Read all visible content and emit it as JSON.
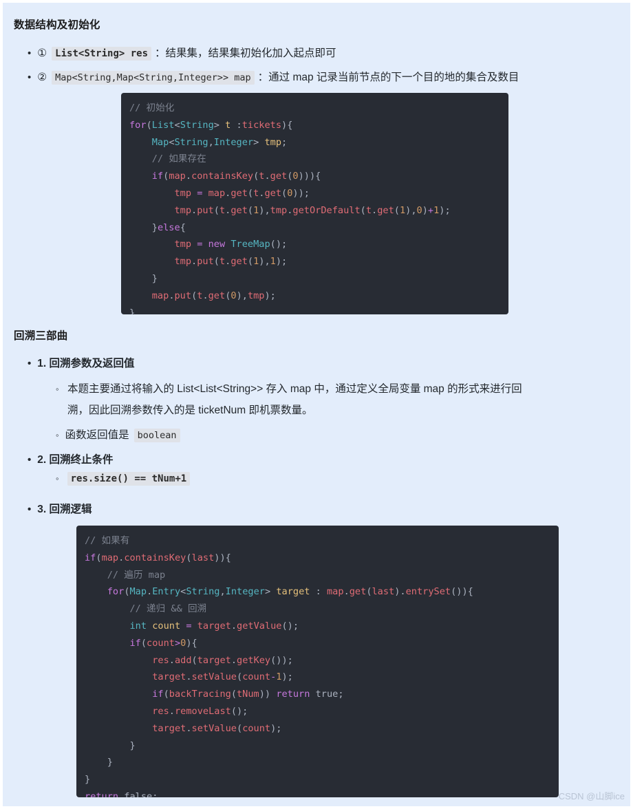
{
  "document": {
    "watermark": "CSDN @山脚ice"
  },
  "section1": {
    "heading": "数据结构及初始化",
    "items": [
      {
        "marker": "①",
        "code": "List<String> res",
        "text": "：结果集，结果集初始化加入起点即可"
      },
      {
        "marker": "②",
        "code": "Map<String,Map<String,Integer>> map",
        "text": "：通过 map 记录当前节点的下一个目的地的集合及数目"
      }
    ]
  },
  "code_block_1": {
    "lines": [
      [
        {
          "t": "// 初始化",
          "c": "c-com"
        }
      ],
      [
        {
          "t": "for",
          "c": "c-kw"
        },
        {
          "t": "(",
          "c": "c-pun"
        },
        {
          "t": "List",
          "c": "c-typ"
        },
        {
          "t": "<",
          "c": "c-pun"
        },
        {
          "t": "String",
          "c": "c-typ"
        },
        {
          "t": "> ",
          "c": "c-pun"
        },
        {
          "t": "t ",
          "c": "c-var"
        },
        {
          "t": ":",
          "c": "c-pun"
        },
        {
          "t": "tickets",
          "c": "c-fn"
        },
        {
          "t": "){",
          "c": "c-pun"
        }
      ],
      [
        {
          "t": "    ",
          "c": "c-pln"
        },
        {
          "t": "Map",
          "c": "c-typ"
        },
        {
          "t": "<",
          "c": "c-pun"
        },
        {
          "t": "String",
          "c": "c-typ"
        },
        {
          "t": ",",
          "c": "c-pun"
        },
        {
          "t": "Integer",
          "c": "c-typ"
        },
        {
          "t": "> ",
          "c": "c-pun"
        },
        {
          "t": "tmp",
          "c": "c-var"
        },
        {
          "t": ";",
          "c": "c-pun"
        }
      ],
      [
        {
          "t": "    ",
          "c": "c-pln"
        },
        {
          "t": "// 如果存在",
          "c": "c-com"
        }
      ],
      [
        {
          "t": "    ",
          "c": "c-pln"
        },
        {
          "t": "if",
          "c": "c-kw"
        },
        {
          "t": "(",
          "c": "c-pun"
        },
        {
          "t": "map",
          "c": "c-fn"
        },
        {
          "t": ".",
          "c": "c-pun"
        },
        {
          "t": "containsKey",
          "c": "c-fn"
        },
        {
          "t": "(",
          "c": "c-pun"
        },
        {
          "t": "t",
          "c": "c-fn"
        },
        {
          "t": ".",
          "c": "c-pun"
        },
        {
          "t": "get",
          "c": "c-fn"
        },
        {
          "t": "(",
          "c": "c-pun"
        },
        {
          "t": "0",
          "c": "c-num"
        },
        {
          "t": "))){",
          "c": "c-pun"
        }
      ],
      [
        {
          "t": "        ",
          "c": "c-pln"
        },
        {
          "t": "tmp ",
          "c": "c-fn"
        },
        {
          "t": "= ",
          "c": "c-op"
        },
        {
          "t": "map",
          "c": "c-fn"
        },
        {
          "t": ".",
          "c": "c-pun"
        },
        {
          "t": "get",
          "c": "c-fn"
        },
        {
          "t": "(",
          "c": "c-pun"
        },
        {
          "t": "t",
          "c": "c-fn"
        },
        {
          "t": ".",
          "c": "c-pun"
        },
        {
          "t": "get",
          "c": "c-fn"
        },
        {
          "t": "(",
          "c": "c-pun"
        },
        {
          "t": "0",
          "c": "c-num"
        },
        {
          "t": "));",
          "c": "c-pun"
        }
      ],
      [
        {
          "t": "        ",
          "c": "c-pln"
        },
        {
          "t": "tmp",
          "c": "c-fn"
        },
        {
          "t": ".",
          "c": "c-pun"
        },
        {
          "t": "put",
          "c": "c-fn"
        },
        {
          "t": "(",
          "c": "c-pun"
        },
        {
          "t": "t",
          "c": "c-fn"
        },
        {
          "t": ".",
          "c": "c-pun"
        },
        {
          "t": "get",
          "c": "c-fn"
        },
        {
          "t": "(",
          "c": "c-pun"
        },
        {
          "t": "1",
          "c": "c-num"
        },
        {
          "t": "),",
          "c": "c-pun"
        },
        {
          "t": "tmp",
          "c": "c-fn"
        },
        {
          "t": ".",
          "c": "c-pun"
        },
        {
          "t": "getOrDefault",
          "c": "c-fn"
        },
        {
          "t": "(",
          "c": "c-pun"
        },
        {
          "t": "t",
          "c": "c-fn"
        },
        {
          "t": ".",
          "c": "c-pun"
        },
        {
          "t": "get",
          "c": "c-fn"
        },
        {
          "t": "(",
          "c": "c-pun"
        },
        {
          "t": "1",
          "c": "c-num"
        },
        {
          "t": "),",
          "c": "c-pun"
        },
        {
          "t": "0",
          "c": "c-num"
        },
        {
          "t": ")",
          "c": "c-pun"
        },
        {
          "t": "+",
          "c": "c-op"
        },
        {
          "t": "1",
          "c": "c-num"
        },
        {
          "t": ");",
          "c": "c-pun"
        }
      ],
      [
        {
          "t": "    ",
          "c": "c-pln"
        },
        {
          "t": "}",
          "c": "c-pun"
        },
        {
          "t": "else",
          "c": "c-kw"
        },
        {
          "t": "{",
          "c": "c-pun"
        }
      ],
      [
        {
          "t": "        ",
          "c": "c-pln"
        },
        {
          "t": "tmp ",
          "c": "c-fn"
        },
        {
          "t": "= ",
          "c": "c-op"
        },
        {
          "t": "new ",
          "c": "c-kw"
        },
        {
          "t": "TreeMap",
          "c": "c-typ"
        },
        {
          "t": "();",
          "c": "c-pun"
        }
      ],
      [
        {
          "t": "        ",
          "c": "c-pln"
        },
        {
          "t": "tmp",
          "c": "c-fn"
        },
        {
          "t": ".",
          "c": "c-pun"
        },
        {
          "t": "put",
          "c": "c-fn"
        },
        {
          "t": "(",
          "c": "c-pun"
        },
        {
          "t": "t",
          "c": "c-fn"
        },
        {
          "t": ".",
          "c": "c-pun"
        },
        {
          "t": "get",
          "c": "c-fn"
        },
        {
          "t": "(",
          "c": "c-pun"
        },
        {
          "t": "1",
          "c": "c-num"
        },
        {
          "t": "),",
          "c": "c-pun"
        },
        {
          "t": "1",
          "c": "c-num"
        },
        {
          "t": ");",
          "c": "c-pun"
        }
      ],
      [
        {
          "t": "    ",
          "c": "c-pln"
        },
        {
          "t": "}",
          "c": "c-pun"
        }
      ],
      [
        {
          "t": "    ",
          "c": "c-pln"
        },
        {
          "t": "map",
          "c": "c-fn"
        },
        {
          "t": ".",
          "c": "c-pun"
        },
        {
          "t": "put",
          "c": "c-fn"
        },
        {
          "t": "(",
          "c": "c-pun"
        },
        {
          "t": "t",
          "c": "c-fn"
        },
        {
          "t": ".",
          "c": "c-pun"
        },
        {
          "t": "get",
          "c": "c-fn"
        },
        {
          "t": "(",
          "c": "c-pun"
        },
        {
          "t": "0",
          "c": "c-num"
        },
        {
          "t": "),",
          "c": "c-pun"
        },
        {
          "t": "tmp",
          "c": "c-fn"
        },
        {
          "t": ");",
          "c": "c-pun"
        }
      ],
      [
        {
          "t": "}",
          "c": "c-pun"
        }
      ]
    ]
  },
  "section2": {
    "heading": "回溯三部曲",
    "item1": {
      "label": "1. 回溯参数及返回值",
      "paragraph_line1": "本题主要通过将输入的 List<List<String>> 存入 map 中，通过定义全局变量 map 的形式来进行回",
      "paragraph_line2": "溯，因此回溯参数传入的是 ticketNum 即机票数量。",
      "subitem_text": "函数返回值是",
      "subitem_code": "boolean"
    },
    "item2": {
      "label": "2. 回溯终止条件",
      "code": "res.size() == tNum+1"
    },
    "item3": {
      "label": "3. 回溯逻辑"
    }
  },
  "code_block_2": {
    "lines": [
      [
        {
          "t": "// 如果有",
          "c": "c-com"
        }
      ],
      [
        {
          "t": "if",
          "c": "c-kw"
        },
        {
          "t": "(",
          "c": "c-pun"
        },
        {
          "t": "map",
          "c": "c-fn"
        },
        {
          "t": ".",
          "c": "c-pun"
        },
        {
          "t": "containsKey",
          "c": "c-fn"
        },
        {
          "t": "(",
          "c": "c-pun"
        },
        {
          "t": "last",
          "c": "c-fn"
        },
        {
          "t": ")){",
          "c": "c-pun"
        }
      ],
      [
        {
          "t": "    ",
          "c": "c-pln"
        },
        {
          "t": "// 遍历 map",
          "c": "c-com"
        }
      ],
      [
        {
          "t": "    ",
          "c": "c-pln"
        },
        {
          "t": "for",
          "c": "c-kw"
        },
        {
          "t": "(",
          "c": "c-pun"
        },
        {
          "t": "Map",
          "c": "c-typ"
        },
        {
          "t": ".",
          "c": "c-pun"
        },
        {
          "t": "Entry",
          "c": "c-typ"
        },
        {
          "t": "<",
          "c": "c-pun"
        },
        {
          "t": "String",
          "c": "c-typ"
        },
        {
          "t": ",",
          "c": "c-pun"
        },
        {
          "t": "Integer",
          "c": "c-typ"
        },
        {
          "t": "> ",
          "c": "c-pun"
        },
        {
          "t": "target ",
          "c": "c-var"
        },
        {
          "t": ": ",
          "c": "c-pun"
        },
        {
          "t": "map",
          "c": "c-fn"
        },
        {
          "t": ".",
          "c": "c-pun"
        },
        {
          "t": "get",
          "c": "c-fn"
        },
        {
          "t": "(",
          "c": "c-pun"
        },
        {
          "t": "last",
          "c": "c-fn"
        },
        {
          "t": ").",
          "c": "c-pun"
        },
        {
          "t": "entrySet",
          "c": "c-fn"
        },
        {
          "t": "()){",
          "c": "c-pun"
        }
      ],
      [
        {
          "t": "        ",
          "c": "c-pln"
        },
        {
          "t": "// 递归 && 回溯",
          "c": "c-com"
        }
      ],
      [
        {
          "t": "        ",
          "c": "c-pln"
        },
        {
          "t": "int ",
          "c": "c-typ"
        },
        {
          "t": "count ",
          "c": "c-var"
        },
        {
          "t": "= ",
          "c": "c-op"
        },
        {
          "t": "target",
          "c": "c-fn"
        },
        {
          "t": ".",
          "c": "c-pun"
        },
        {
          "t": "getValue",
          "c": "c-fn"
        },
        {
          "t": "();",
          "c": "c-pun"
        }
      ],
      [
        {
          "t": "        ",
          "c": "c-pln"
        },
        {
          "t": "if",
          "c": "c-kw"
        },
        {
          "t": "(",
          "c": "c-pun"
        },
        {
          "t": "count",
          "c": "c-fn"
        },
        {
          "t": ">",
          "c": "c-op"
        },
        {
          "t": "0",
          "c": "c-num"
        },
        {
          "t": "){",
          "c": "c-pun"
        }
      ],
      [
        {
          "t": "            ",
          "c": "c-pln"
        },
        {
          "t": "res",
          "c": "c-fn"
        },
        {
          "t": ".",
          "c": "c-pun"
        },
        {
          "t": "add",
          "c": "c-fn"
        },
        {
          "t": "(",
          "c": "c-pun"
        },
        {
          "t": "target",
          "c": "c-fn"
        },
        {
          "t": ".",
          "c": "c-pun"
        },
        {
          "t": "getKey",
          "c": "c-fn"
        },
        {
          "t": "());",
          "c": "c-pun"
        }
      ],
      [
        {
          "t": "            ",
          "c": "c-pln"
        },
        {
          "t": "target",
          "c": "c-fn"
        },
        {
          "t": ".",
          "c": "c-pun"
        },
        {
          "t": "setValue",
          "c": "c-fn"
        },
        {
          "t": "(",
          "c": "c-pun"
        },
        {
          "t": "count",
          "c": "c-fn"
        },
        {
          "t": "-",
          "c": "c-op"
        },
        {
          "t": "1",
          "c": "c-num"
        },
        {
          "t": ");",
          "c": "c-pun"
        }
      ],
      [
        {
          "t": "            ",
          "c": "c-pln"
        },
        {
          "t": "if",
          "c": "c-kw"
        },
        {
          "t": "(",
          "c": "c-pun"
        },
        {
          "t": "backTracing",
          "c": "c-fn"
        },
        {
          "t": "(",
          "c": "c-pun"
        },
        {
          "t": "tNum",
          "c": "c-fn"
        },
        {
          "t": ")) ",
          "c": "c-pun"
        },
        {
          "t": "return ",
          "c": "c-kw"
        },
        {
          "t": "true",
          "c": "c-pln"
        },
        {
          "t": ";",
          "c": "c-pun"
        }
      ],
      [
        {
          "t": "            ",
          "c": "c-pln"
        },
        {
          "t": "res",
          "c": "c-fn"
        },
        {
          "t": ".",
          "c": "c-pun"
        },
        {
          "t": "removeLast",
          "c": "c-fn"
        },
        {
          "t": "();",
          "c": "c-pun"
        }
      ],
      [
        {
          "t": "            ",
          "c": "c-pln"
        },
        {
          "t": "target",
          "c": "c-fn"
        },
        {
          "t": ".",
          "c": "c-pun"
        },
        {
          "t": "setValue",
          "c": "c-fn"
        },
        {
          "t": "(",
          "c": "c-pun"
        },
        {
          "t": "count",
          "c": "c-fn"
        },
        {
          "t": ");",
          "c": "c-pun"
        }
      ],
      [
        {
          "t": "        ",
          "c": "c-pln"
        },
        {
          "t": "}",
          "c": "c-pun"
        }
      ],
      [
        {
          "t": "    ",
          "c": "c-pln"
        },
        {
          "t": "}",
          "c": "c-pun"
        }
      ],
      [
        {
          "t": "}",
          "c": "c-pun"
        }
      ],
      [
        {
          "t": "return ",
          "c": "c-kw"
        },
        {
          "t": "false",
          "c": "c-pln"
        },
        {
          "t": ";",
          "c": "c-pun"
        }
      ]
    ]
  }
}
